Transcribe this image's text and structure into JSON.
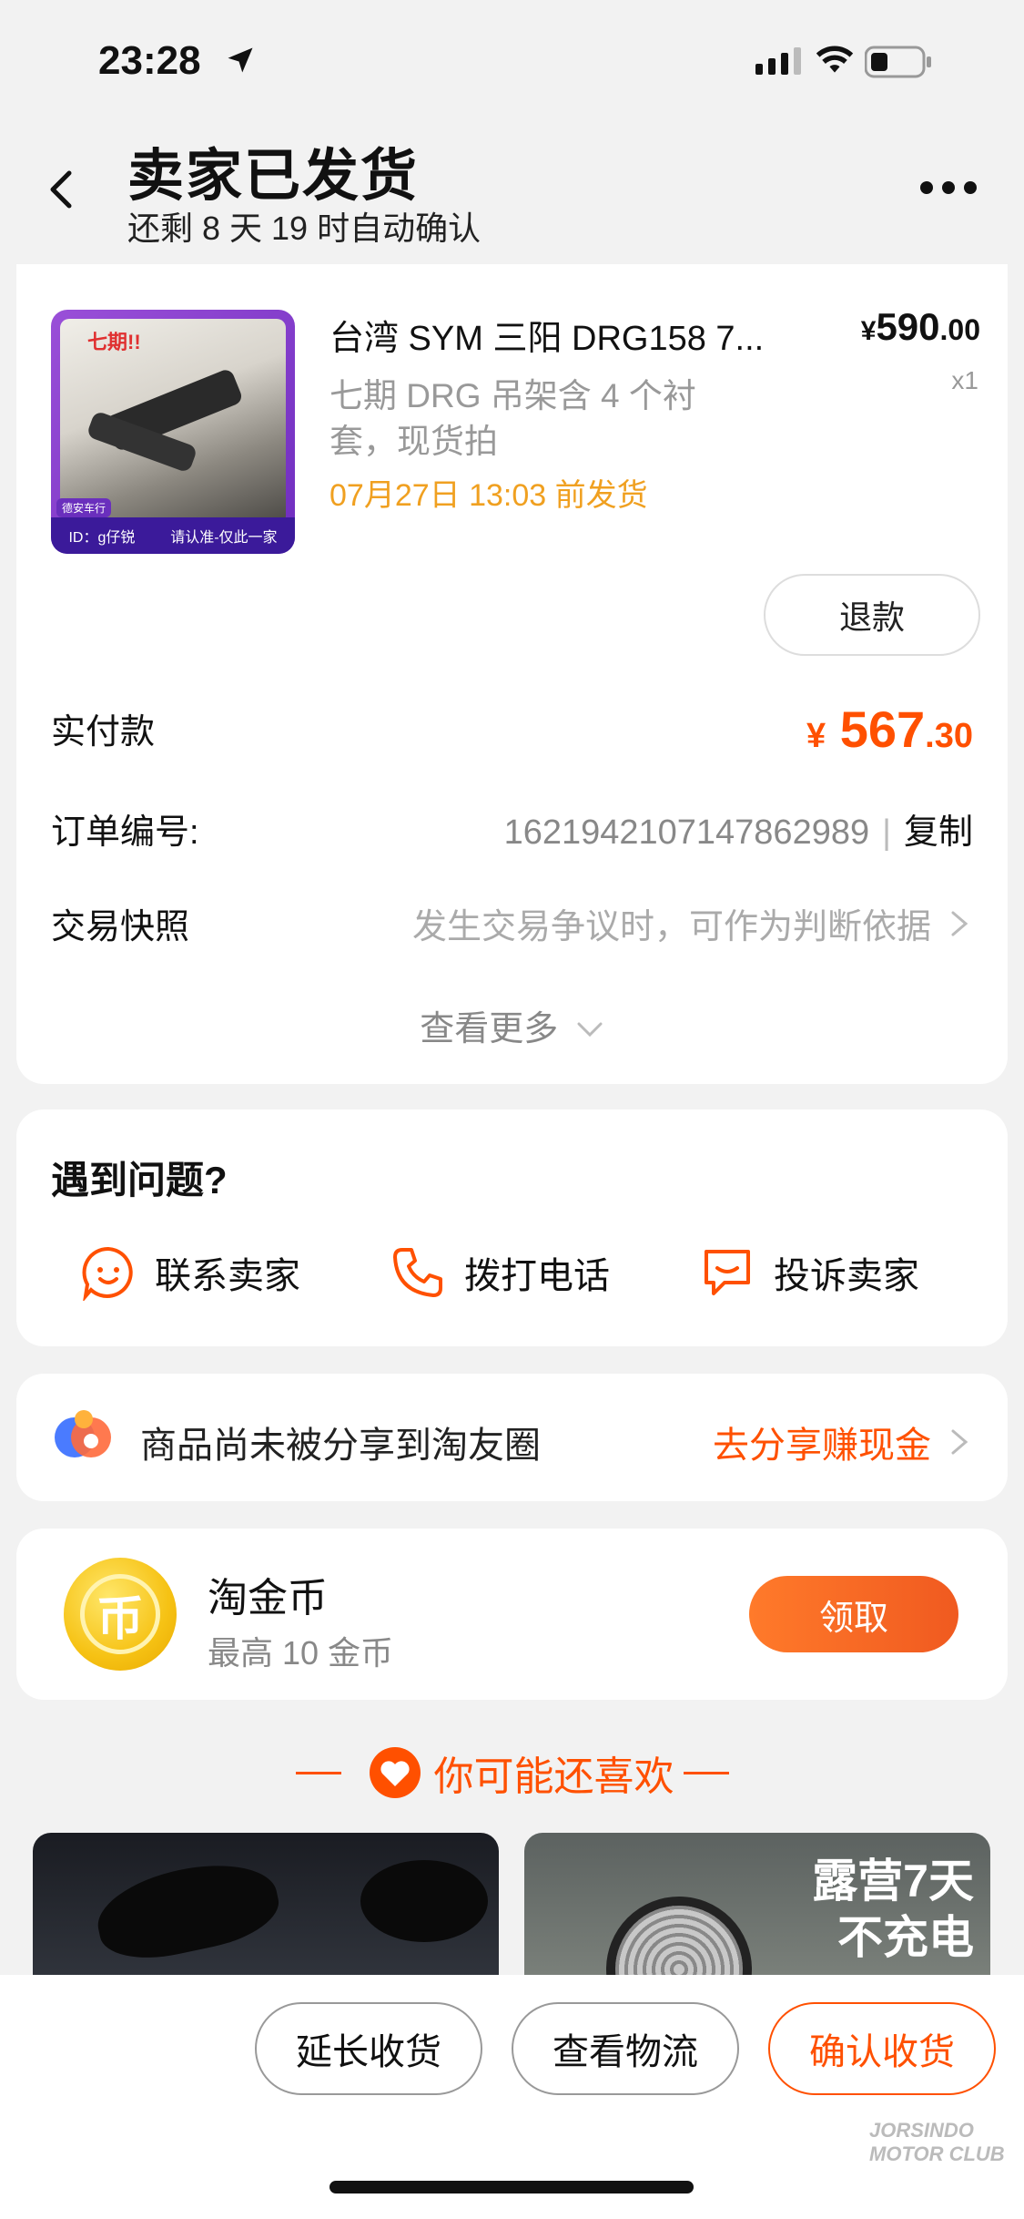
{
  "status_bar": {
    "time": "23:28"
  },
  "header": {
    "title": "卖家已发货",
    "subtitle": "还剩 8 天 19 时自动确认"
  },
  "product": {
    "thumb_tag": "七期!!",
    "thumb_shop": "德安车行",
    "thumb_banner_left": "ID：g仔锐",
    "thumb_banner_right": "请认准-仅此一家",
    "title": "台湾 SYM 三阳 DRG158 7...",
    "price_symbol": "¥",
    "price_int": "590",
    "price_dec": ".00",
    "quantity": "x1",
    "spec": "七期 DRG 吊架含 4 个衬套，现货拍",
    "ship_note": "07月27日 13:03 前发货",
    "refund_label": "退款"
  },
  "order": {
    "paid_label": "实付款",
    "paid_symbol": "¥",
    "paid_int": "567",
    "paid_dec": ".30",
    "number_label": "订单编号:",
    "number_value": "1621942107147862989",
    "separator": "|",
    "copy_label": "复制",
    "snapshot_label": "交易快照",
    "snapshot_value": "发生交易争议时，可作为判断依据",
    "more_label": "查看更多"
  },
  "help": {
    "title": "遇到问题?",
    "actions": [
      {
        "label": "联系卖家",
        "icon": "chat-face-icon"
      },
      {
        "label": "拨打电话",
        "icon": "phone-icon"
      },
      {
        "label": "投诉卖家",
        "icon": "complaint-icon"
      }
    ]
  },
  "share": {
    "text": "商品尚未被分享到淘友圈",
    "link": "去分享赚现金"
  },
  "coins": {
    "title": "淘金币",
    "subtitle": "最高 10 金币",
    "button": "领取",
    "coin_glyph": "币"
  },
  "recommend": {
    "title": "你可能还喜欢",
    "tile2_text_line1": "露营7天",
    "tile2_text_line2": "不充电"
  },
  "bottom_bar": {
    "extend": "延长收货",
    "logistics": "查看物流",
    "confirm": "确认收货"
  },
  "watermark": "JORSINDO MOTOR CLUB",
  "colors": {
    "accent": "#ff5000",
    "ship_note": "#f0a020",
    "background": "#f2f2f2"
  }
}
